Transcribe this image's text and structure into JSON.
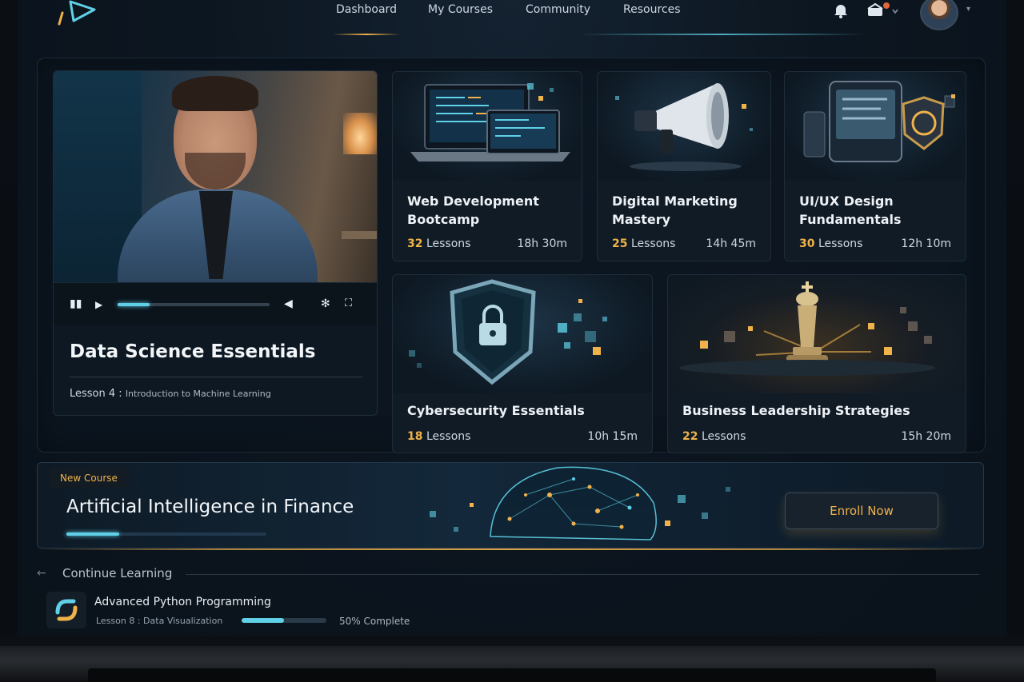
{
  "nav": {
    "links": [
      "Dashboard",
      "My Courses",
      "Community",
      "Resources"
    ],
    "icons": [
      "logo-icon",
      "bell-icon",
      "notifications-icon",
      "avatar",
      "chevron-down-icon"
    ]
  },
  "featured": {
    "title": "Data Science Essentials",
    "lesson_prefix": "Lesson 4 :",
    "lesson_name": "Introduction to Machine Learning",
    "video_progress": 0.21
  },
  "courses": [
    {
      "title_line1": "Web Development",
      "title_line2": "Bootcamp",
      "lessons": "32",
      "lessons_label": "Lessons",
      "duration": "18h 30m"
    },
    {
      "title_line1": "Digital Marketing",
      "title_line2": "Mastery",
      "lessons": "25",
      "lessons_label": "Lessons",
      "duration": "14h 45m"
    },
    {
      "title_line1": "UI/UX Design",
      "title_line2": "Fundamentals",
      "lessons": "30",
      "lessons_label": "Lessons",
      "duration": "12h 10m"
    },
    {
      "title_line1": "Cybersecurity Essentials",
      "title_line2": "",
      "lessons": "18",
      "lessons_label": "Lessons",
      "duration": "10h 15m"
    },
    {
      "title_line1": "Business Leadership Strategies",
      "title_line2": "",
      "lessons": "22",
      "lessons_label": "Lessons",
      "duration": "15h 20m"
    }
  ],
  "banner": {
    "badge": "New Course",
    "title": "Artificial Intelligence in Finance",
    "cta": "Enroll Now"
  },
  "continue": {
    "heading": "Continue Learning",
    "course_title": "Advanced Python Programming",
    "lesson": "Lesson 8 : Data Visualization",
    "progress_text": "50% Complete",
    "progress": 0.5
  },
  "colors": {
    "accent_cyan": "#5fd0e6",
    "accent_gold": "#f0b24a",
    "background": "#0c1620"
  }
}
